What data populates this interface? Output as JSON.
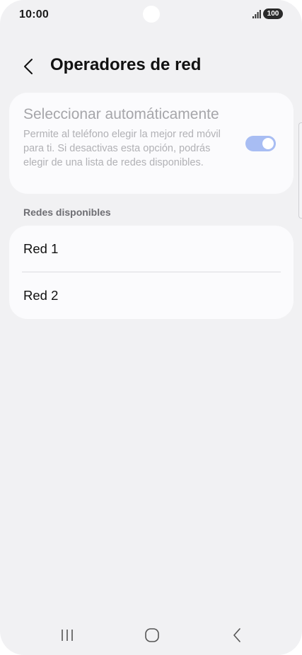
{
  "status": {
    "time": "10:00",
    "battery": "100"
  },
  "header": {
    "title": "Operadores de red"
  },
  "auto_select": {
    "title": "Seleccionar automáticamente",
    "description": "Permite al teléfono elegir la mejor red móvil para ti. Si desactivas esta opción, podrás elegir de una lista de redes disponibles.",
    "enabled": true
  },
  "networks": {
    "section_label": "Redes disponibles",
    "items": [
      {
        "label": "Red 1"
      },
      {
        "label": "Red 2"
      }
    ]
  },
  "colors": {
    "background": "#f1f1f3",
    "card": "#fbfbfd",
    "toggle_on_disabled": "#a8bdf3"
  },
  "icons": {
    "back": "chevron-left-icon",
    "nav_recent": "recent-apps-icon",
    "nav_home": "home-icon",
    "nav_back": "back-icon"
  }
}
